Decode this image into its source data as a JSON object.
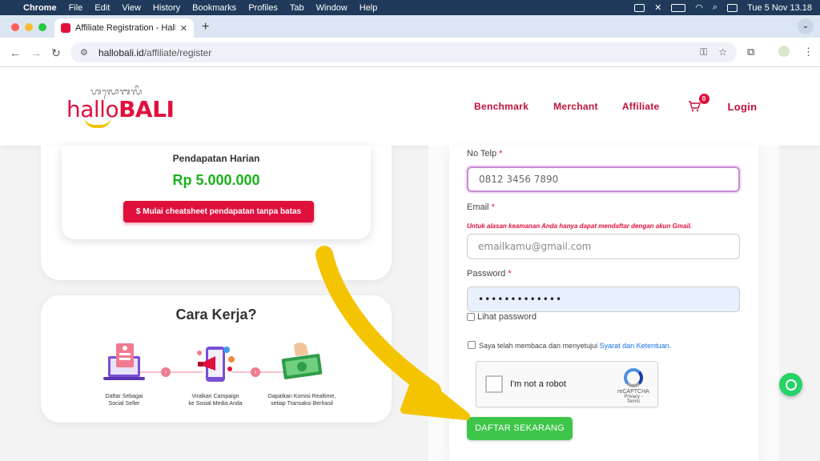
{
  "menubar": {
    "apple": "",
    "app": "Chrome",
    "items": [
      "File",
      "Edit",
      "View",
      "History",
      "Bookmarks",
      "Profiles",
      "Tab",
      "Window",
      "Help"
    ],
    "clock": "Tue 5 Nov  13.18"
  },
  "browser": {
    "tab_title": "Affiliate Registration - HalloB",
    "new_tab": "+",
    "url_host": "hallobali.id",
    "url_path": "/affiliate/register"
  },
  "site": {
    "logo_script": "ᬳᬮᭀᬩᬮᬶ",
    "logo_hallo": "hallo",
    "logo_bali": "BALI",
    "nav": [
      "Benchmark",
      "Merchant",
      "Affiliate"
    ],
    "cart_count": "0",
    "login": "Login"
  },
  "income": {
    "label": "Pendapatan Harian",
    "amount": "Rp 5.000.000",
    "cta": "$ Mulai cheatsheet pendapatan tanpa batas"
  },
  "how": {
    "title": "Cara Kerja?",
    "steps": [
      {
        "caption1": "Daftar Sebagai",
        "caption2": "Social Seller"
      },
      {
        "caption1": "Viralkan Campaign",
        "caption2": "ke Sosial Media Anda"
      },
      {
        "caption1": "Dapatkan Komisi Realtime,",
        "caption2": "setiap Transaksi Berhasil"
      }
    ]
  },
  "form": {
    "phone_label": "No Telp",
    "phone_value": "0812 3456 7890",
    "email_label": "Email",
    "email_note": "Untuk alasan keamanan Anda hanya dapat mendaftar dengan akun Gmail.",
    "email_placeholder": "emailkamu@gmail.com",
    "password_label": "Password",
    "password_value": "•••••••••••••",
    "show_password": "Lihat password",
    "required_mark": "*",
    "terms_prefix": "Saya telah membaca dan menyetujui ",
    "terms_link": "Syarat dan Ketentuan.",
    "captcha_text": "I'm not a robot",
    "captcha_brand": "reCAPTCHA",
    "captcha_links": "Privacy - Terms",
    "submit": "DAFTAR SEKARANG"
  },
  "colors": {
    "brand_red": "#e0103d",
    "brand_yellow": "#f2c300",
    "success_green": "#3ec64a",
    "amount_green": "#1bb21b",
    "whatsapp": "#25d366",
    "annotation_arrow": "#f5c400"
  }
}
